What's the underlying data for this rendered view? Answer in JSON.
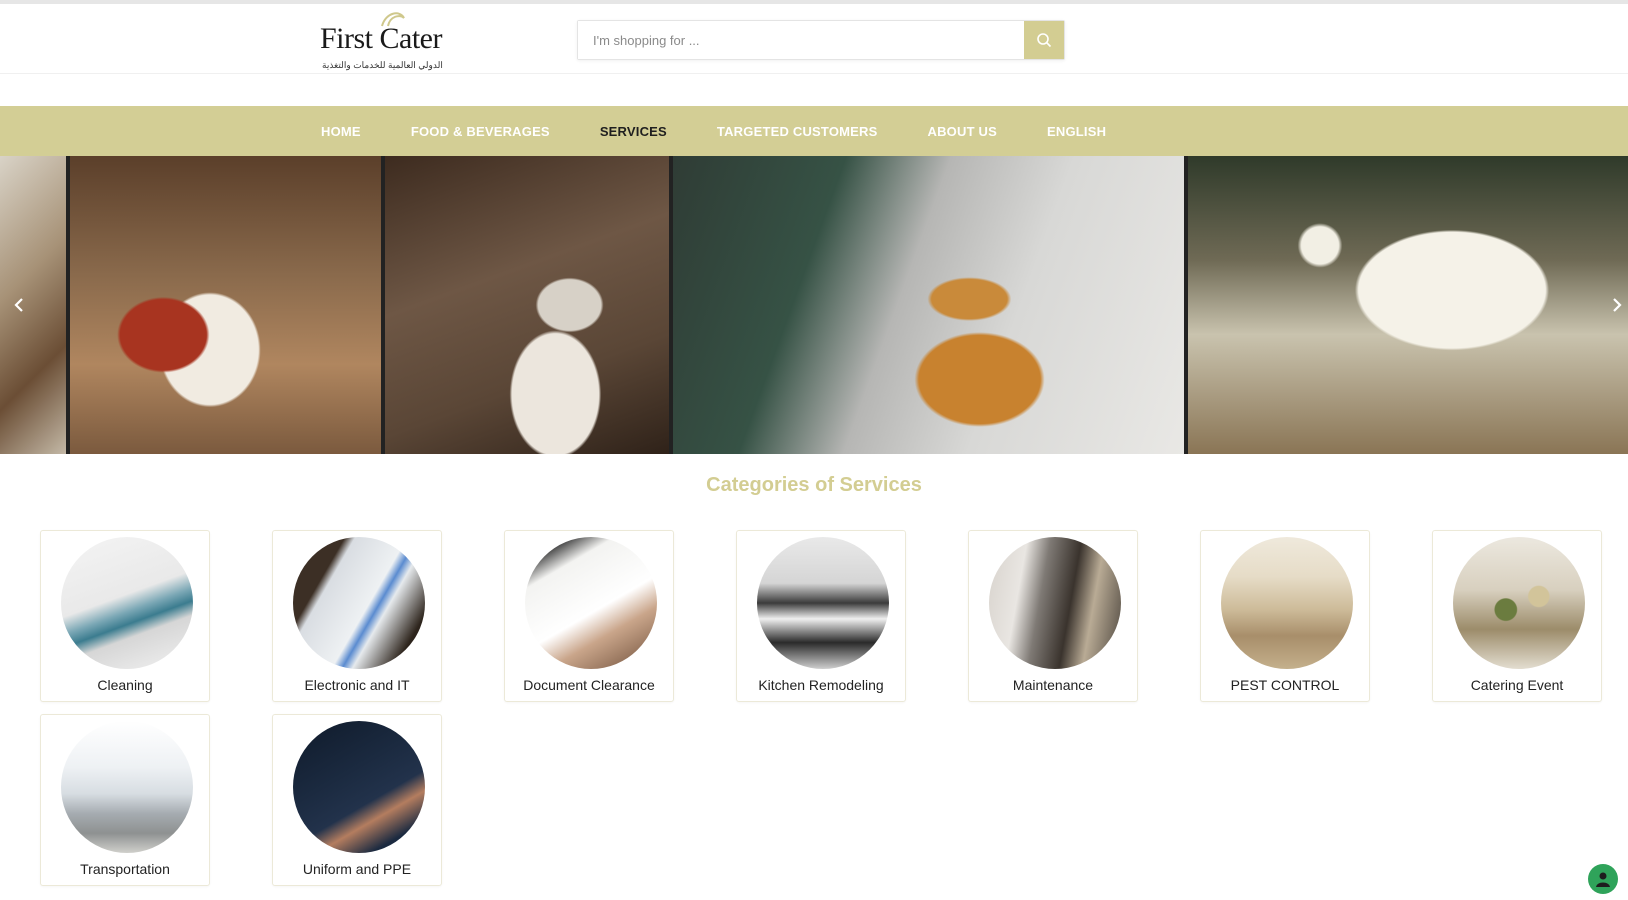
{
  "header": {
    "logo_text": "First Cater",
    "logo_tagline": "الدولي العالمية للخدمات والتغذية",
    "search_placeholder": "I'm shopping for ..."
  },
  "nav": {
    "items": [
      {
        "label": "HOME"
      },
      {
        "label": "FOOD & BEVERAGES"
      },
      {
        "label": "SERVICES"
      },
      {
        "label": "TARGETED CUSTOMERS"
      },
      {
        "label": "ABOUT US"
      },
      {
        "label": "ENGLISH"
      }
    ],
    "active": "SERVICES"
  },
  "section": {
    "title": "Categories of Services"
  },
  "categories": [
    {
      "label": "Cleaning"
    },
    {
      "label": "Electronic and IT"
    },
    {
      "label": "Document Clearance"
    },
    {
      "label": "Kitchen Remodeling"
    },
    {
      "label": "Maintenance"
    },
    {
      "label": "PEST CONTROL"
    },
    {
      "label": "Catering Event"
    },
    {
      "label": "Transportation"
    },
    {
      "label": "Uniform and PPE"
    }
  ],
  "colors": {
    "accent": "#d3ce95",
    "accent_text": "#d3cd92",
    "nav_active": "#1f1f1f"
  },
  "icons": {
    "search": "search-icon",
    "prev": "chevron-left-icon",
    "next": "chevron-right-icon",
    "chat": "chat-avatar-icon"
  }
}
